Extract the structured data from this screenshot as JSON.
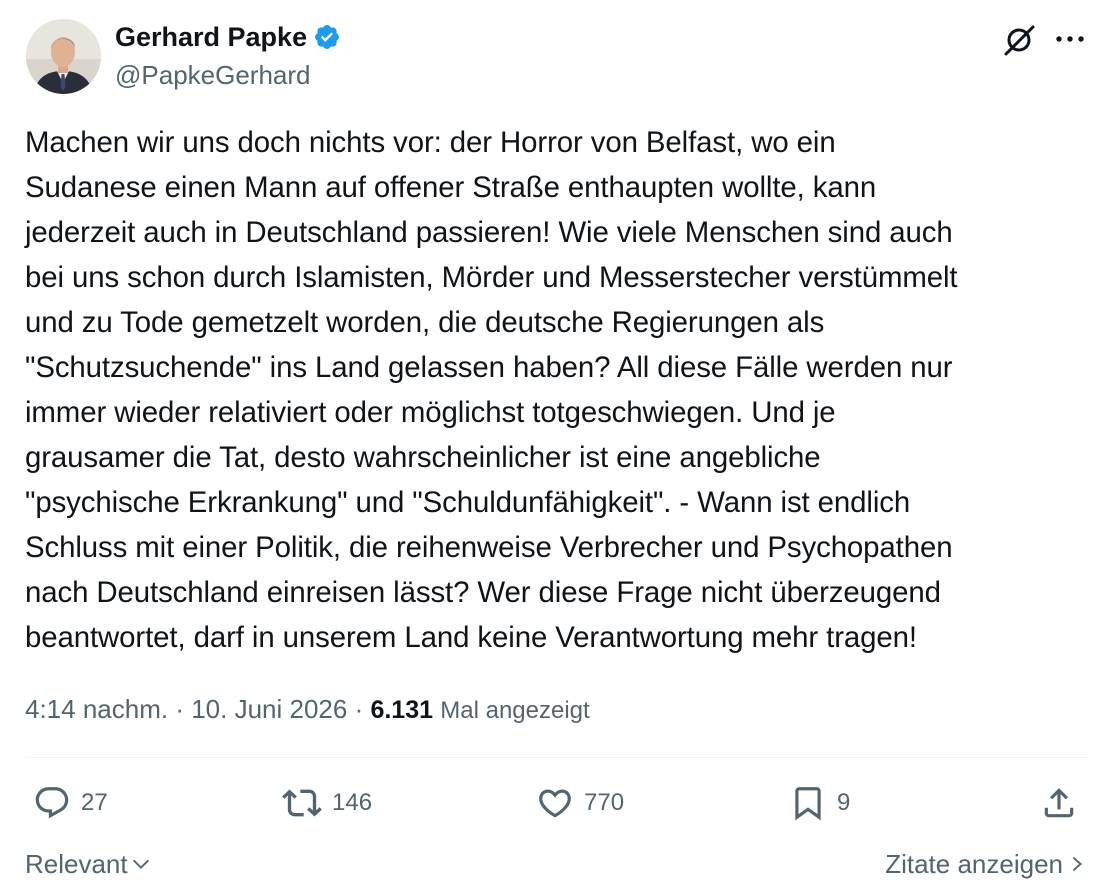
{
  "author": {
    "display_name": "Gerhard Papke",
    "handle": "@PapkeGerhard",
    "verified": true,
    "verified_color": "#1d9bf0"
  },
  "header_icons": [
    "grok-icon",
    "more-options-icon"
  ],
  "tweet": {
    "text": "Machen wir uns doch nichts vor: der Horror von Belfast, wo ein\nSudanese einen Mann auf offener Straße enthaupten wollte, kann\njederzeit auch in Deutschland passieren! Wie viele Menschen sind auch\nbei uns schon durch Islamisten, Mörder und Messerstecher verstümmelt\nund zu Tode gemetzelt worden, die deutsche Regierungen als\n\"Schutzsuchende\" ins Land gelassen haben? All diese Fälle werden nur\nimmer wieder relativiert oder möglichst totgeschwiegen. Und je\ngrausamer die Tat, desto wahrscheinlicher ist eine angebliche\n\"psychische Erkrankung\" und \"Schuldunfähigkeit\". - Wann ist endlich\nSchluss mit einer Politik, die reihenweise Verbrecher und Psychopathen\nnach Deutschland einreisen lässt? Wer diese Frage nicht überzeugend\nbeantwortet, darf in unserem Land keine Verantwortung mehr tragen!"
  },
  "meta": {
    "time": "4:14 nachm.",
    "separator": " · ",
    "date": "10. Juni 2026",
    "views_count": "6.131",
    "views_label": "Mal angezeigt"
  },
  "actions": {
    "replies": "27",
    "reposts": "146",
    "likes": "770",
    "bookmarks": "9"
  },
  "footer": {
    "sort_label": "Relevant",
    "quotes_label": "Zitate anzeigen"
  },
  "colors": {
    "text": "#0f1419",
    "secondary": "#536471",
    "divider": "#eff3f4",
    "verified": "#1d9bf0"
  }
}
